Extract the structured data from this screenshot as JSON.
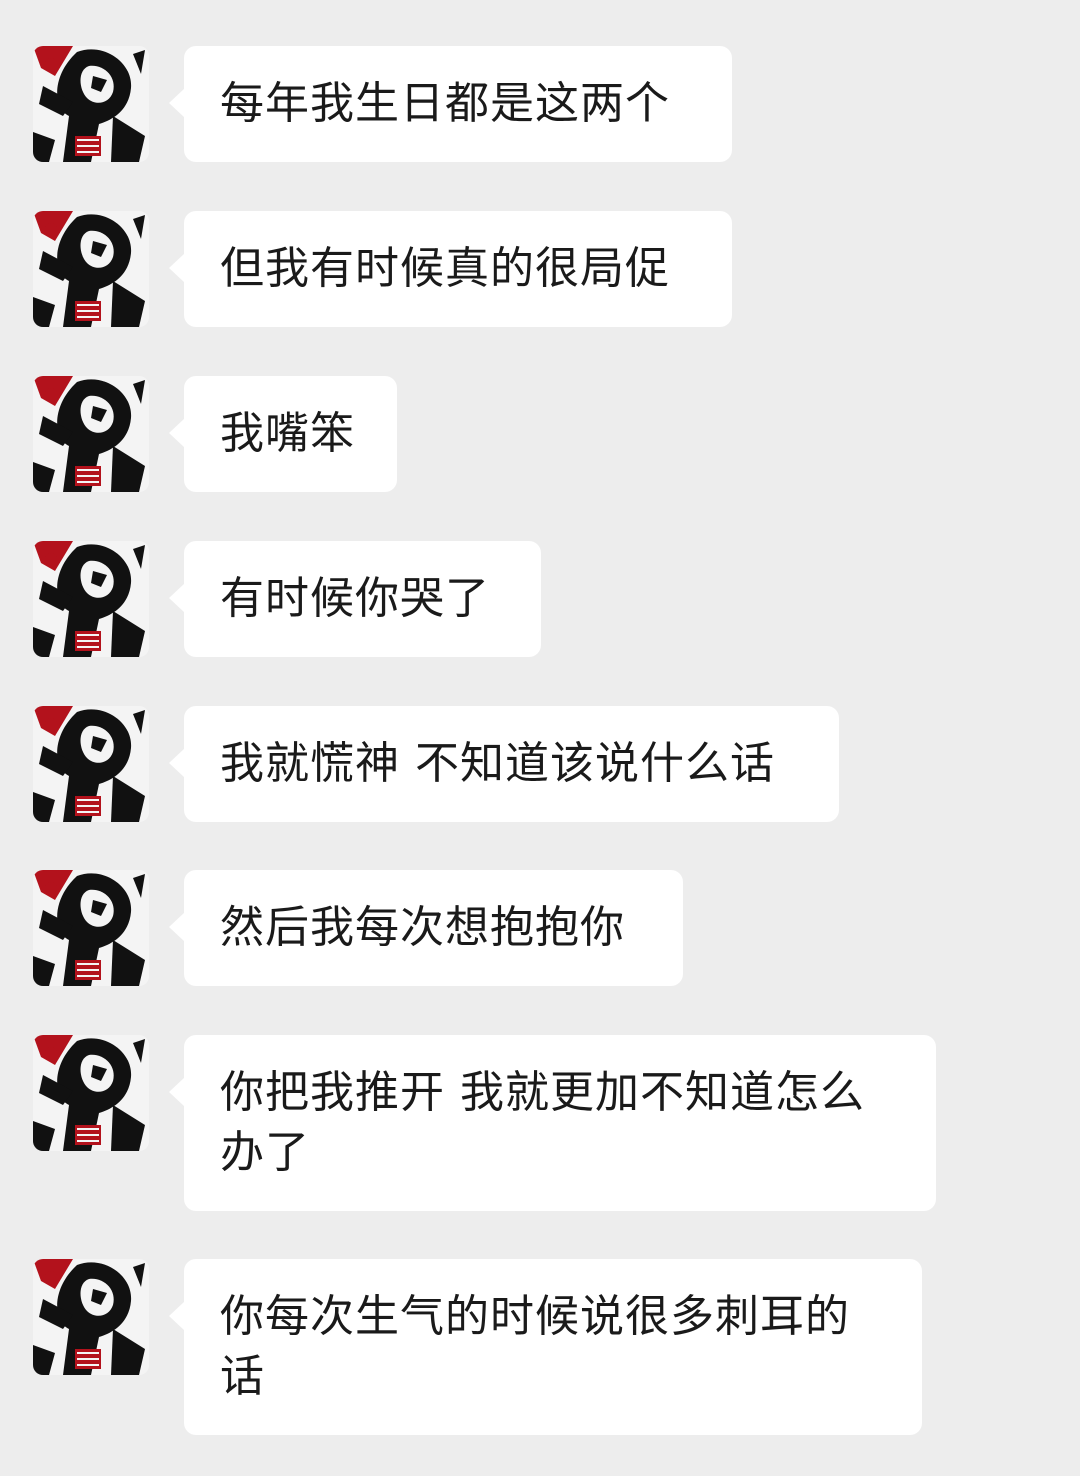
{
  "avatar": {
    "icon": "manga-character-avatar-icon",
    "colors": {
      "ink": "#111111",
      "accent_red": "#b3121c",
      "paper": "#f4f4f4"
    }
  },
  "theme": {
    "background": "#ededed",
    "bubble": "#ffffff",
    "text": "#1a1a1a"
  },
  "messages": [
    {
      "text": "每年我生日都是这两个"
    },
    {
      "text": "但我有时候真的很局促"
    },
    {
      "text": "我嘴笨"
    },
    {
      "text": "有时候你哭了"
    },
    {
      "text": "我就慌神 不知道该说什么话"
    },
    {
      "text": "然后我每次想抱抱你"
    },
    {
      "text": "你把我推开 我就更加不知道怎么办了"
    },
    {
      "text": "你每次生气的时候说很多刺耳的话"
    }
  ]
}
